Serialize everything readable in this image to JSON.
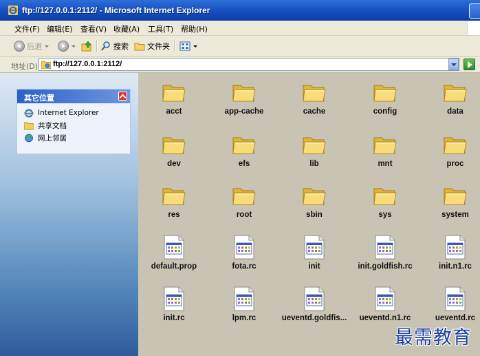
{
  "window": {
    "title": "ftp://127.0.0.1:2112/ - Microsoft Internet Explorer"
  },
  "menu": [
    "文件(F)",
    "编辑(E)",
    "查看(V)",
    "收藏(A)",
    "工具(T)",
    "帮助(H)"
  ],
  "toolbar": {
    "back": "后退",
    "search": "搜索",
    "folders": "文件夹"
  },
  "address": {
    "label": "地址(D)",
    "url": "ftp://127.0.0.1:2112/"
  },
  "other_places": {
    "title": "其它位置",
    "items": [
      "Internet Explorer",
      "共享文档",
      "网上邻居"
    ]
  },
  "files": [
    {
      "name": "acct",
      "type": "folder"
    },
    {
      "name": "app-cache",
      "type": "folder"
    },
    {
      "name": "cache",
      "type": "folder"
    },
    {
      "name": "config",
      "type": "folder"
    },
    {
      "name": "data",
      "type": "folder"
    },
    {
      "name": "dev",
      "type": "folder"
    },
    {
      "name": "efs",
      "type": "folder"
    },
    {
      "name": "lib",
      "type": "folder"
    },
    {
      "name": "mnt",
      "type": "folder"
    },
    {
      "name": "proc",
      "type": "folder"
    },
    {
      "name": "res",
      "type": "folder"
    },
    {
      "name": "root",
      "type": "folder"
    },
    {
      "name": "sbin",
      "type": "folder"
    },
    {
      "name": "sys",
      "type": "folder"
    },
    {
      "name": "system",
      "type": "folder"
    },
    {
      "name": "default.prop",
      "type": "file"
    },
    {
      "name": "fota.rc",
      "type": "file"
    },
    {
      "name": "init",
      "type": "file"
    },
    {
      "name": "init.goldfish.rc",
      "type": "file"
    },
    {
      "name": "init.n1.rc",
      "type": "file"
    },
    {
      "name": "init.rc",
      "type": "file"
    },
    {
      "name": "lpm.rc",
      "type": "file"
    },
    {
      "name": "ueventd.goldfis...",
      "type": "file"
    },
    {
      "name": "ueventd.n1.rc",
      "type": "file"
    },
    {
      "name": "ueventd.rc",
      "type": "file"
    }
  ],
  "watermark": "最需教育"
}
